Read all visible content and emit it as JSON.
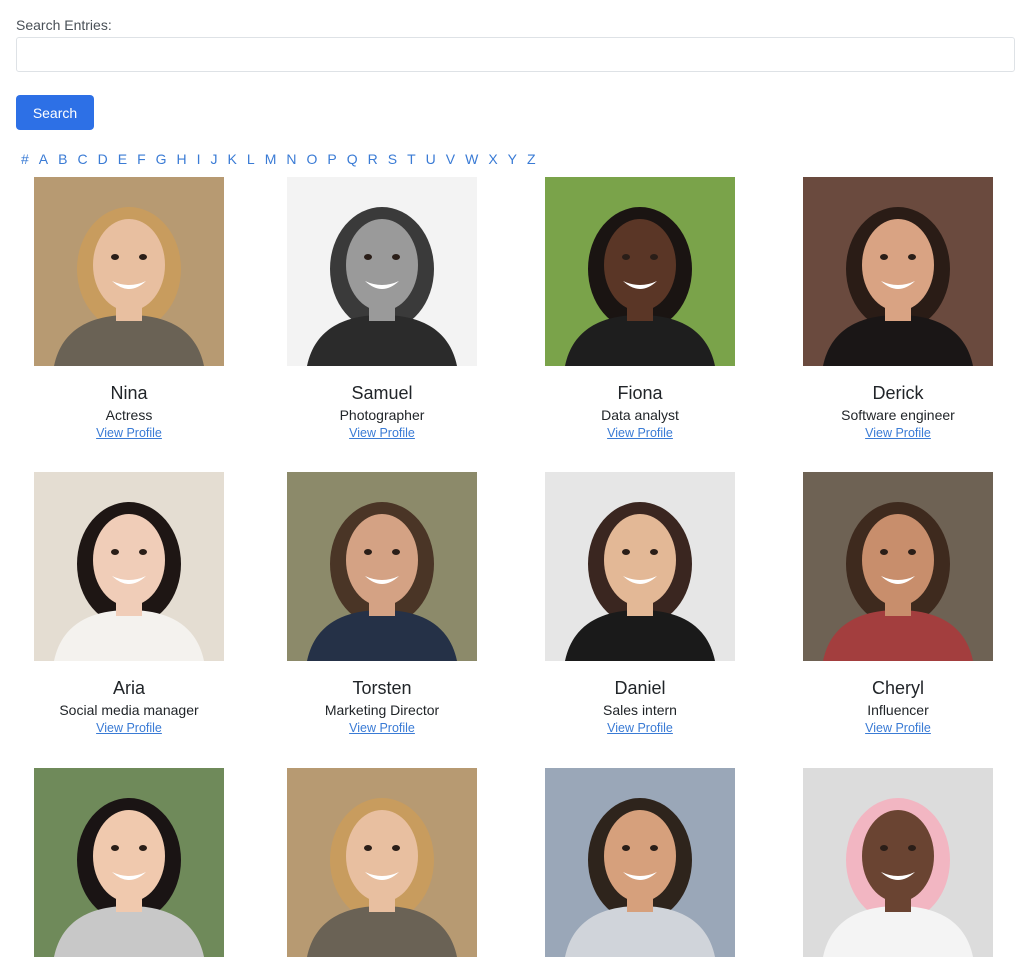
{
  "search": {
    "label": "Search Entries:",
    "value": "",
    "placeholder": "",
    "button_label": "Search"
  },
  "alphabet": [
    "#",
    "A",
    "B",
    "C",
    "D",
    "E",
    "F",
    "G",
    "H",
    "I",
    "J",
    "K",
    "L",
    "M",
    "N",
    "O",
    "P",
    "Q",
    "R",
    "S",
    "T",
    "U",
    "V",
    "W",
    "X",
    "Y",
    "Z"
  ],
  "link_label": "View Profile",
  "profiles": [
    {
      "name": "Nina",
      "role": "Actress",
      "bg": "#b79a72",
      "skin": "#e8bfa0",
      "hair": "#c89c5e",
      "shirt": "#6a6255"
    },
    {
      "name": "Samuel",
      "role": "Photographer",
      "bg": "#f3f3f3",
      "skin": "#9a9a9a",
      "hair": "#3a3a3a",
      "shirt": "#2b2b2b"
    },
    {
      "name": "Fiona",
      "role": "Data analyst",
      "bg": "#7aa34a",
      "skin": "#5a3626",
      "hair": "#1a1412",
      "shirt": "#1e1e1e"
    },
    {
      "name": "Derick",
      "role": "Software engineer",
      "bg": "#6a4a3e",
      "skin": "#d9a383",
      "hair": "#2a1c16",
      "shirt": "#1a1616"
    },
    {
      "name": "Aria",
      "role": "Social media manager",
      "bg": "#e4ddd2",
      "skin": "#f0cdb8",
      "hair": "#1e1614",
      "shirt": "#f4f2ee"
    },
    {
      "name": "Torsten",
      "role": "Marketing Director",
      "bg": "#8c8a6a",
      "skin": "#d4a284",
      "hair": "#4a3526",
      "shirt": "#253147"
    },
    {
      "name": "Daniel",
      "role": "Sales intern",
      "bg": "#e6e6e6",
      "skin": "#e3b896",
      "hair": "#3a2620",
      "shirt": "#1a1a1a"
    },
    {
      "name": "Cheryl",
      "role": "Influencer",
      "bg": "#6e6254",
      "skin": "#c88e6c",
      "hair": "#3e2a1e",
      "shirt": "#a33e3e"
    },
    {
      "name": "",
      "role": "",
      "bg": "#6f8a5a",
      "skin": "#f0c9ae",
      "hair": "#1a1414",
      "shirt": "#c8c8c8"
    },
    {
      "name": "",
      "role": "",
      "bg": "#b79a72",
      "skin": "#e8bfa0",
      "hair": "#c89c5e",
      "shirt": "#6a6255"
    },
    {
      "name": "",
      "role": "",
      "bg": "#9aa7b8",
      "skin": "#d6a07c",
      "hair": "#2e241c",
      "shirt": "#d0d4da"
    },
    {
      "name": "",
      "role": "",
      "bg": "#dcdcdc",
      "skin": "#6a4432",
      "hair": "#f2b6c2",
      "shirt": "#f4f4f4"
    }
  ]
}
